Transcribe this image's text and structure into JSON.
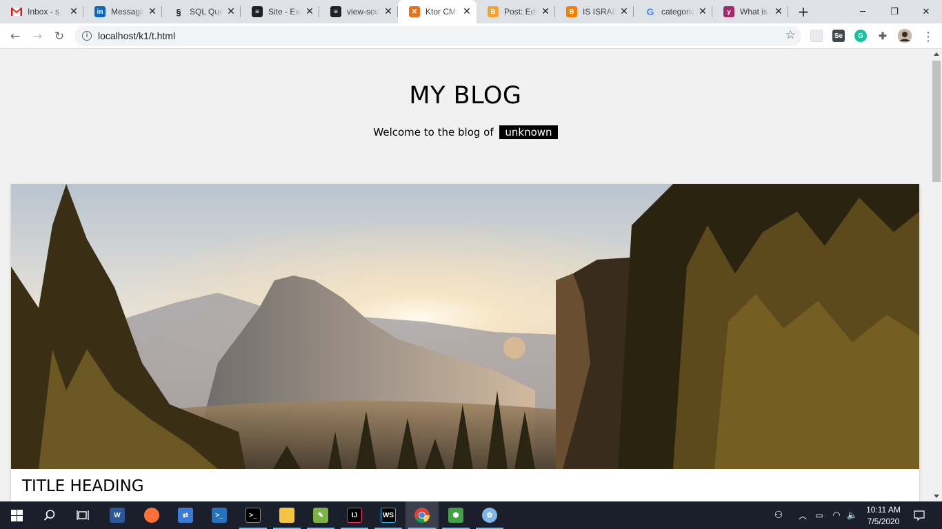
{
  "browser": {
    "tabs": [
      {
        "title": "Inbox - s",
        "icon": "gmail-icon",
        "color": "#ffffff"
      },
      {
        "title": "Messaging",
        "icon": "linkedin-icon",
        "color": "#0a66c2"
      },
      {
        "title": "SQL Quer",
        "icon": "sql-icon",
        "color": "#ffffff"
      },
      {
        "title": "Site - Exa",
        "icon": "document-icon",
        "color": "#202124"
      },
      {
        "title": "view-sou",
        "icon": "document-icon",
        "color": "#202124"
      },
      {
        "title": "Ktor CMS",
        "icon": "ktor-icon",
        "color": "#e8711a"
      },
      {
        "title": "Post: Edit",
        "icon": "blogger-icon",
        "color": "#f6a22f"
      },
      {
        "title": "IS ISRAEL",
        "icon": "blogger-icon",
        "color": "#f57d00"
      },
      {
        "title": "categorie",
        "icon": "google-icon",
        "color": "#ffffff"
      },
      {
        "title": "What is t",
        "icon": "yoast-icon",
        "color": "#a4286a"
      }
    ],
    "active_tab": 5,
    "new_tab_label": "+",
    "window_controls": {
      "minimize": "─",
      "restore": "❐",
      "close": "✕"
    },
    "nav": {
      "back": "←",
      "forward": "→",
      "reload": "↻"
    },
    "url": "localhost/k1/t.html",
    "bookmark_icon": "☆",
    "extensions": [
      {
        "name": "extension-icon",
        "label": ""
      },
      {
        "name": "selenium-icon",
        "label": "Se"
      },
      {
        "name": "grammarly-icon",
        "label": "G"
      },
      {
        "name": "puzzle-icon",
        "label": "✚"
      }
    ],
    "menu": "⋮"
  },
  "page": {
    "blog_title": "MY BLOG",
    "welcome_text": "Welcome to the blog of",
    "author": "unknown",
    "post_title": "TITLE HEADING"
  },
  "taskbar": {
    "apps": [
      {
        "name": "taskbar-start-icon",
        "glyph": "⊞",
        "color": "#1b1f2b"
      },
      {
        "name": "taskbar-search-icon",
        "glyph": "⌕",
        "color": "#1b1f2b"
      },
      {
        "name": "taskbar-taskview-icon",
        "glyph": "⧉",
        "color": "#1b1f2b"
      },
      {
        "name": "taskbar-word-icon",
        "glyph": "W",
        "color": "#2b579a"
      },
      {
        "name": "taskbar-firefox-icon",
        "glyph": "",
        "color": "#ff7139"
      },
      {
        "name": "taskbar-network-app-icon",
        "glyph": "",
        "color": "#3a7bd5"
      },
      {
        "name": "taskbar-powershell-icon",
        "glyph": ">_",
        "color": "#2671be"
      },
      {
        "name": "taskbar-terminal-icon",
        "glyph": ">_",
        "color": "#000000"
      },
      {
        "name": "taskbar-explorer-icon",
        "glyph": "",
        "color": "#f4c542"
      },
      {
        "name": "taskbar-notepad-icon",
        "glyph": "",
        "color": "#7cb342"
      },
      {
        "name": "taskbar-intellij-icon",
        "glyph": "IJ",
        "color": "#000000"
      },
      {
        "name": "taskbar-webstorm-icon",
        "glyph": "WS",
        "color": "#07c3f2"
      },
      {
        "name": "taskbar-chrome-icon",
        "glyph": "",
        "color": "#4285f4"
      },
      {
        "name": "taskbar-3d-icon",
        "glyph": "",
        "color": "#43a047"
      },
      {
        "name": "taskbar-paint-icon",
        "glyph": "",
        "color": "#7fb8e8"
      }
    ],
    "time": "10:11 AM",
    "date": "7/5/2020"
  }
}
